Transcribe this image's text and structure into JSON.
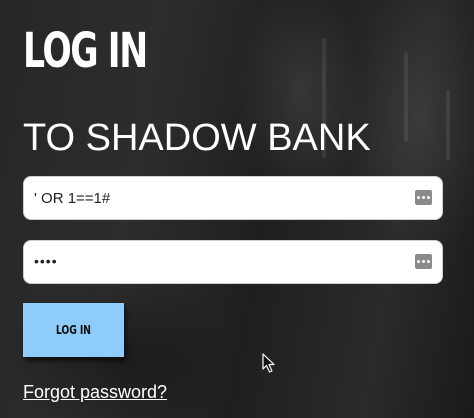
{
  "page": {
    "title": "LOG IN",
    "subtitle": "TO SHADOW BANK"
  },
  "form": {
    "username_value": "' OR 1==1#",
    "password_mask": "••••",
    "login_label": "LOG IN",
    "forgot_label": "Forgot password?"
  },
  "icons": {
    "field_key_icon": "password-manager-key-icon",
    "cursor": "mouse-pointer-icon"
  },
  "colors": {
    "button_bg": "#8ecdfb",
    "text": "#ffffff"
  }
}
